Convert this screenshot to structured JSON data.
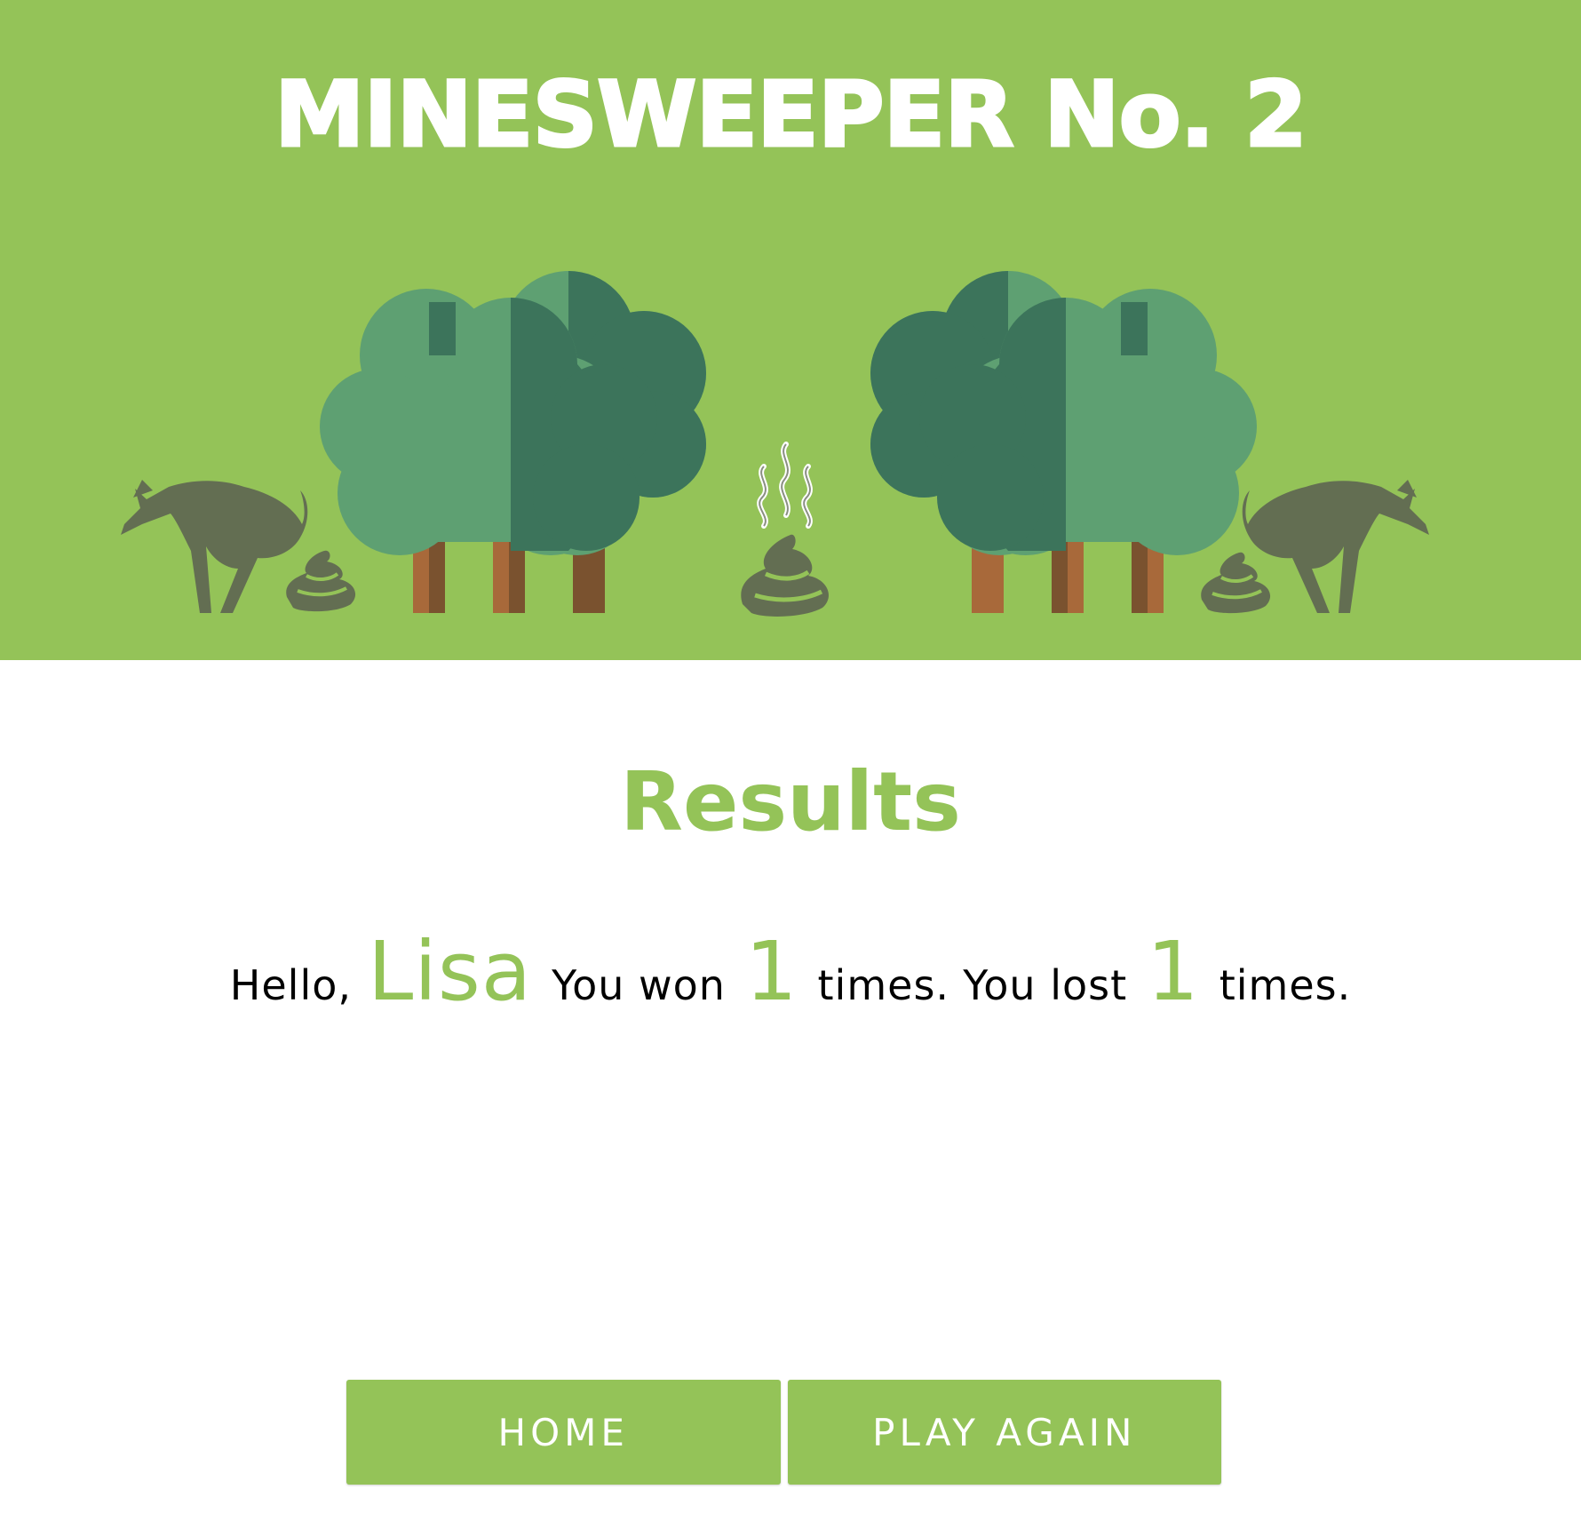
{
  "app": {
    "title": "MINESWEEPER No. 2"
  },
  "results": {
    "heading": "Results",
    "greeting": "Hello,",
    "player_name": "Lisa",
    "won_prefix": "You won",
    "won_count": "1",
    "won_suffix": "times.",
    "lost_prefix": "You lost",
    "lost_count": "1",
    "lost_suffix": "times."
  },
  "buttons": {
    "home": "HOME",
    "play_again": "PLAY AGAIN"
  },
  "colors": {
    "accent": "#94c358",
    "tree_light": "#5ea072",
    "tree_dark": "#3c745b",
    "trunk": "#a8693a",
    "trunk_shade": "#7a522f",
    "dog_and_poop": "#636e52"
  },
  "icons": {
    "banner": [
      "dog-icon",
      "poop-icon",
      "tree-icon",
      "steam-icon"
    ]
  }
}
